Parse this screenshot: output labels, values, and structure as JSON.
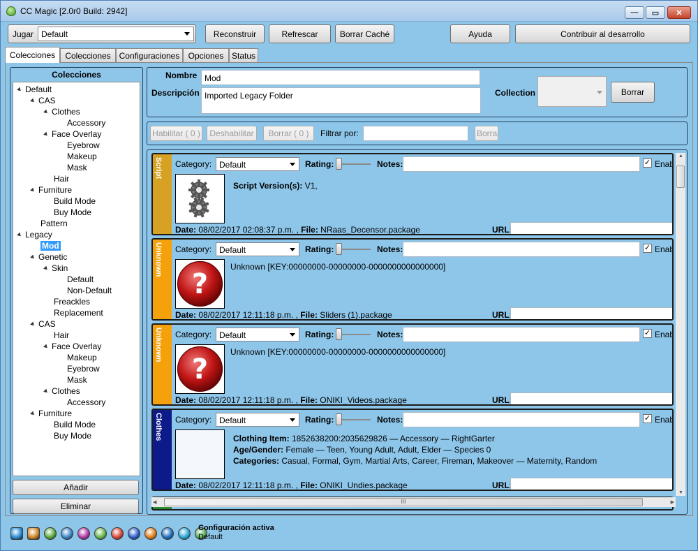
{
  "window": {
    "title": "CC Magic [2.0r0 Build: 2942]",
    "controls": {
      "minimize": "—",
      "maximize": "▭",
      "close": "✕"
    }
  },
  "toolbar": {
    "jugar_label": "Jugar",
    "jugar_value": "Default",
    "reconstruir": "Reconstruir",
    "refrescar": "Refrescar",
    "borrar_cache": "Borrar Caché",
    "ayuda": "Ayuda",
    "contribuir": "Contribuir al desarrollo"
  },
  "tabs": [
    "Colecciones",
    "Colecciones",
    "Configuraciones",
    "Opciones",
    "Status"
  ],
  "left_panel": {
    "title": "Colecciones",
    "tree": [
      {
        "label": "Default",
        "depth": 0,
        "expanded": true
      },
      {
        "label": "CAS",
        "depth": 1,
        "expanded": true
      },
      {
        "label": "Clothes",
        "depth": 2,
        "expanded": true
      },
      {
        "label": "Accessory",
        "depth": 3,
        "expanded": false
      },
      {
        "label": "Face Overlay",
        "depth": 2,
        "expanded": true
      },
      {
        "label": "Eyebrow",
        "depth": 3,
        "expanded": false
      },
      {
        "label": "Makeup",
        "depth": 3,
        "expanded": false
      },
      {
        "label": "Mask",
        "depth": 3,
        "expanded": false
      },
      {
        "label": "Hair",
        "depth": 2,
        "expanded": false
      },
      {
        "label": "Furniture",
        "depth": 1,
        "expanded": true
      },
      {
        "label": "Build Mode",
        "depth": 2,
        "expanded": false
      },
      {
        "label": "Buy Mode",
        "depth": 2,
        "expanded": false
      },
      {
        "label": "Pattern",
        "depth": 1,
        "expanded": false
      },
      {
        "label": "Legacy",
        "depth": 0,
        "expanded": true
      },
      {
        "label": "Mod",
        "depth": 1,
        "expanded": false,
        "selected": true
      },
      {
        "label": "Genetic",
        "depth": 1,
        "expanded": true
      },
      {
        "label": "Skin",
        "depth": 2,
        "expanded": true
      },
      {
        "label": "Default",
        "depth": 3,
        "expanded": false
      },
      {
        "label": "Non-Default",
        "depth": 3,
        "expanded": false
      },
      {
        "label": "Freackles",
        "depth": 2,
        "expanded": false
      },
      {
        "label": "Replacement",
        "depth": 2,
        "expanded": false
      },
      {
        "label": "CAS",
        "depth": 1,
        "expanded": true
      },
      {
        "label": "Hair",
        "depth": 2,
        "expanded": false
      },
      {
        "label": "Face Overlay",
        "depth": 2,
        "expanded": true
      },
      {
        "label": "Makeup",
        "depth": 3,
        "expanded": false
      },
      {
        "label": "Eyebrow",
        "depth": 3,
        "expanded": false
      },
      {
        "label": "Mask",
        "depth": 3,
        "expanded": false
      },
      {
        "label": "Clothes",
        "depth": 2,
        "expanded": true
      },
      {
        "label": "Accessory",
        "depth": 3,
        "expanded": false
      },
      {
        "label": "Furniture",
        "depth": 1,
        "expanded": true
      },
      {
        "label": "Build Mode",
        "depth": 2,
        "expanded": false
      },
      {
        "label": "Buy Mode",
        "depth": 2,
        "expanded": false
      }
    ],
    "add_button": "Añadir",
    "delete_button": "Eliminar"
  },
  "details": {
    "nombre_label": "Nombre",
    "nombre_value": "Mod",
    "descripcion_label": "Descripción",
    "descripcion_value": "Imported Legacy Folder",
    "collection_label": "Collection",
    "collection_value": "",
    "borrar_button": "Borrar"
  },
  "filter_bar": {
    "habilitar": "Habilitar ( 0 )",
    "deshabilitar": "Deshabilitar",
    "borrar": "Borrar ( 0 )",
    "filtrar_label": "Filtrar por:",
    "filtrar_value": "",
    "borrar_filter": "Borrar"
  },
  "entry_labels": {
    "category": "Category:",
    "rating": "Rating:",
    "notes": "Notes:",
    "enable": "Enab",
    "date": "Date:",
    "file": "File:",
    "url": "URL:"
  },
  "entries": [
    {
      "type": "Script",
      "color": "#d7a223",
      "category": "Default",
      "rating": 0,
      "enabled": true,
      "thumbnail": "gears-icon",
      "detail_lines": [
        {
          "label": "Script Version(s):",
          "value": "V1,"
        }
      ],
      "date": "08/02/2017 02:08:37 p.m. ,",
      "file": "NRaas_Decensor.package"
    },
    {
      "type": "Unknown",
      "color": "#f5a10c",
      "category": "Default",
      "rating": 0,
      "enabled": true,
      "thumbnail": "question-mark-icon",
      "detail_lines": [
        {
          "label": "",
          "value": "Unknown [KEY:00000000-00000000-0000000000000000]"
        }
      ],
      "date": "08/02/2017 12:11:18 p.m. ,",
      "file": "Sliders (1).package"
    },
    {
      "type": "Unknown",
      "color": "#f5a10c",
      "category": "Default",
      "rating": 0,
      "enabled": true,
      "thumbnail": "question-mark-icon",
      "detail_lines": [
        {
          "label": "",
          "value": "Unknown [KEY:00000000-00000000-0000000000000000]"
        }
      ],
      "date": "08/02/2017 12:11:18 p.m. ,",
      "file": "ONIKI_Videos.package"
    },
    {
      "type": "Clothes",
      "color": "#0d1a8a",
      "category": "Default",
      "rating": 0,
      "enabled": true,
      "thumbnail": "blank-thumbnail",
      "detail_lines": [
        {
          "label": "Clothing Item:",
          "value": "1852638200:2035629826 — Accessory — RightGarter"
        },
        {
          "label": "Age/Gender:",
          "value": "Female — Teen, Young Adult, Adult, Elder — Species 0"
        },
        {
          "label": "Categories:",
          "value": "Casual, Formal, Gym, Martial Arts, Career, Fireman, Makeover — Maternity, Random"
        }
      ],
      "date": "08/02/2017 12:11:18 p.m. ,",
      "file": "ONIKI_Undies.package"
    }
  ],
  "scrollbar": {
    "h_grip": "III"
  },
  "status": {
    "title": "Configuración activa",
    "value": "Default",
    "pack_icons": [
      "base-game-icon",
      "world-adventures-icon",
      "ambitions-icon",
      "late-night-icon",
      "generations-icon",
      "pets-icon",
      "showtime-icon",
      "supernatural-icon",
      "seasons-icon",
      "university-icon",
      "island-paradise-icon",
      "into-the-future-icon"
    ],
    "pack_colors": [
      "#2f8fd6",
      "#d08a2a",
      "#5aa83a",
      "#3a86c8",
      "#b23aa8",
      "#66b54a",
      "#d9463a",
      "#2e5fc9",
      "#e07d1a",
      "#1e6fc0",
      "#2aa7d6",
      "#58b058"
    ]
  }
}
